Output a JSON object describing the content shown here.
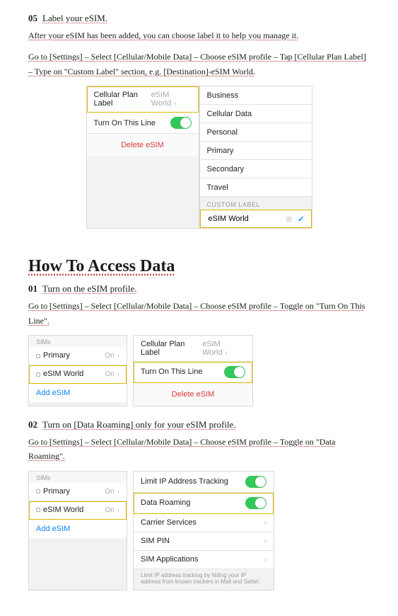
{
  "step05": {
    "num": "05",
    "title": "Label your eSIM.",
    "line1a": "After your eSIM has been added, you can choose label it to help you manage it.",
    "line2": "Go to [Settings] – Select [Cellular/Mobile Data] – Choose eSIM profile – Tap [Cellular Plan Label] – Type on \"Custom Label\" section, e.g. [Destination]-eSIM World."
  },
  "fig05": {
    "cellPlanLabel": "Cellular Plan Label",
    "cellPlanValue": "eSIM World",
    "turnOn": "Turn On This Line",
    "delete": "Delete eSIM",
    "labels": [
      "Business",
      "Cellular Data",
      "Personal",
      "Primary",
      "Secondary",
      "Travel"
    ],
    "customHead": "CUSTOM LABEL",
    "customValue": "eSIM World"
  },
  "heading": "How To Access Data",
  "step01": {
    "num": "01",
    "title": "Turn on the eSIM profile.",
    "line": "Go to [Settings] – Select [Cellular/Mobile Data] – Choose eSIM profile – Toggle on \"Turn On This Line\"."
  },
  "fig01": {
    "simsHead": "SIMs",
    "primary": "Primary",
    "esim": "eSIM World",
    "on": "On",
    "add": "Add eSIM",
    "cellPlanLabel": "Cellular Plan Label",
    "cellPlanValue": "eSIM World",
    "turnOn": "Turn On This Line",
    "delete": "Delete eSIM"
  },
  "step02": {
    "num": "02",
    "title": "Turn on [Data Roaming] only for your eSIM profile.",
    "line": "Go to [Settings] – Select [Cellular/Mobile Data] – Choose eSIM profile – Toggle on \"Data Roaming\"."
  },
  "fig02": {
    "simsHead": "SIMs",
    "primary": "Primary",
    "esim": "eSIM World",
    "on": "On",
    "add": "Add eSIM",
    "limitIP": "Limit IP Address Tracking",
    "roaming": "Data Roaming",
    "carrier": "Carrier Services",
    "simpin": "SIM PIN",
    "simapps": "SIM Applications",
    "fine": "Limit IP address tracking by hiding your IP address from known trackers in Mail and Safari."
  }
}
